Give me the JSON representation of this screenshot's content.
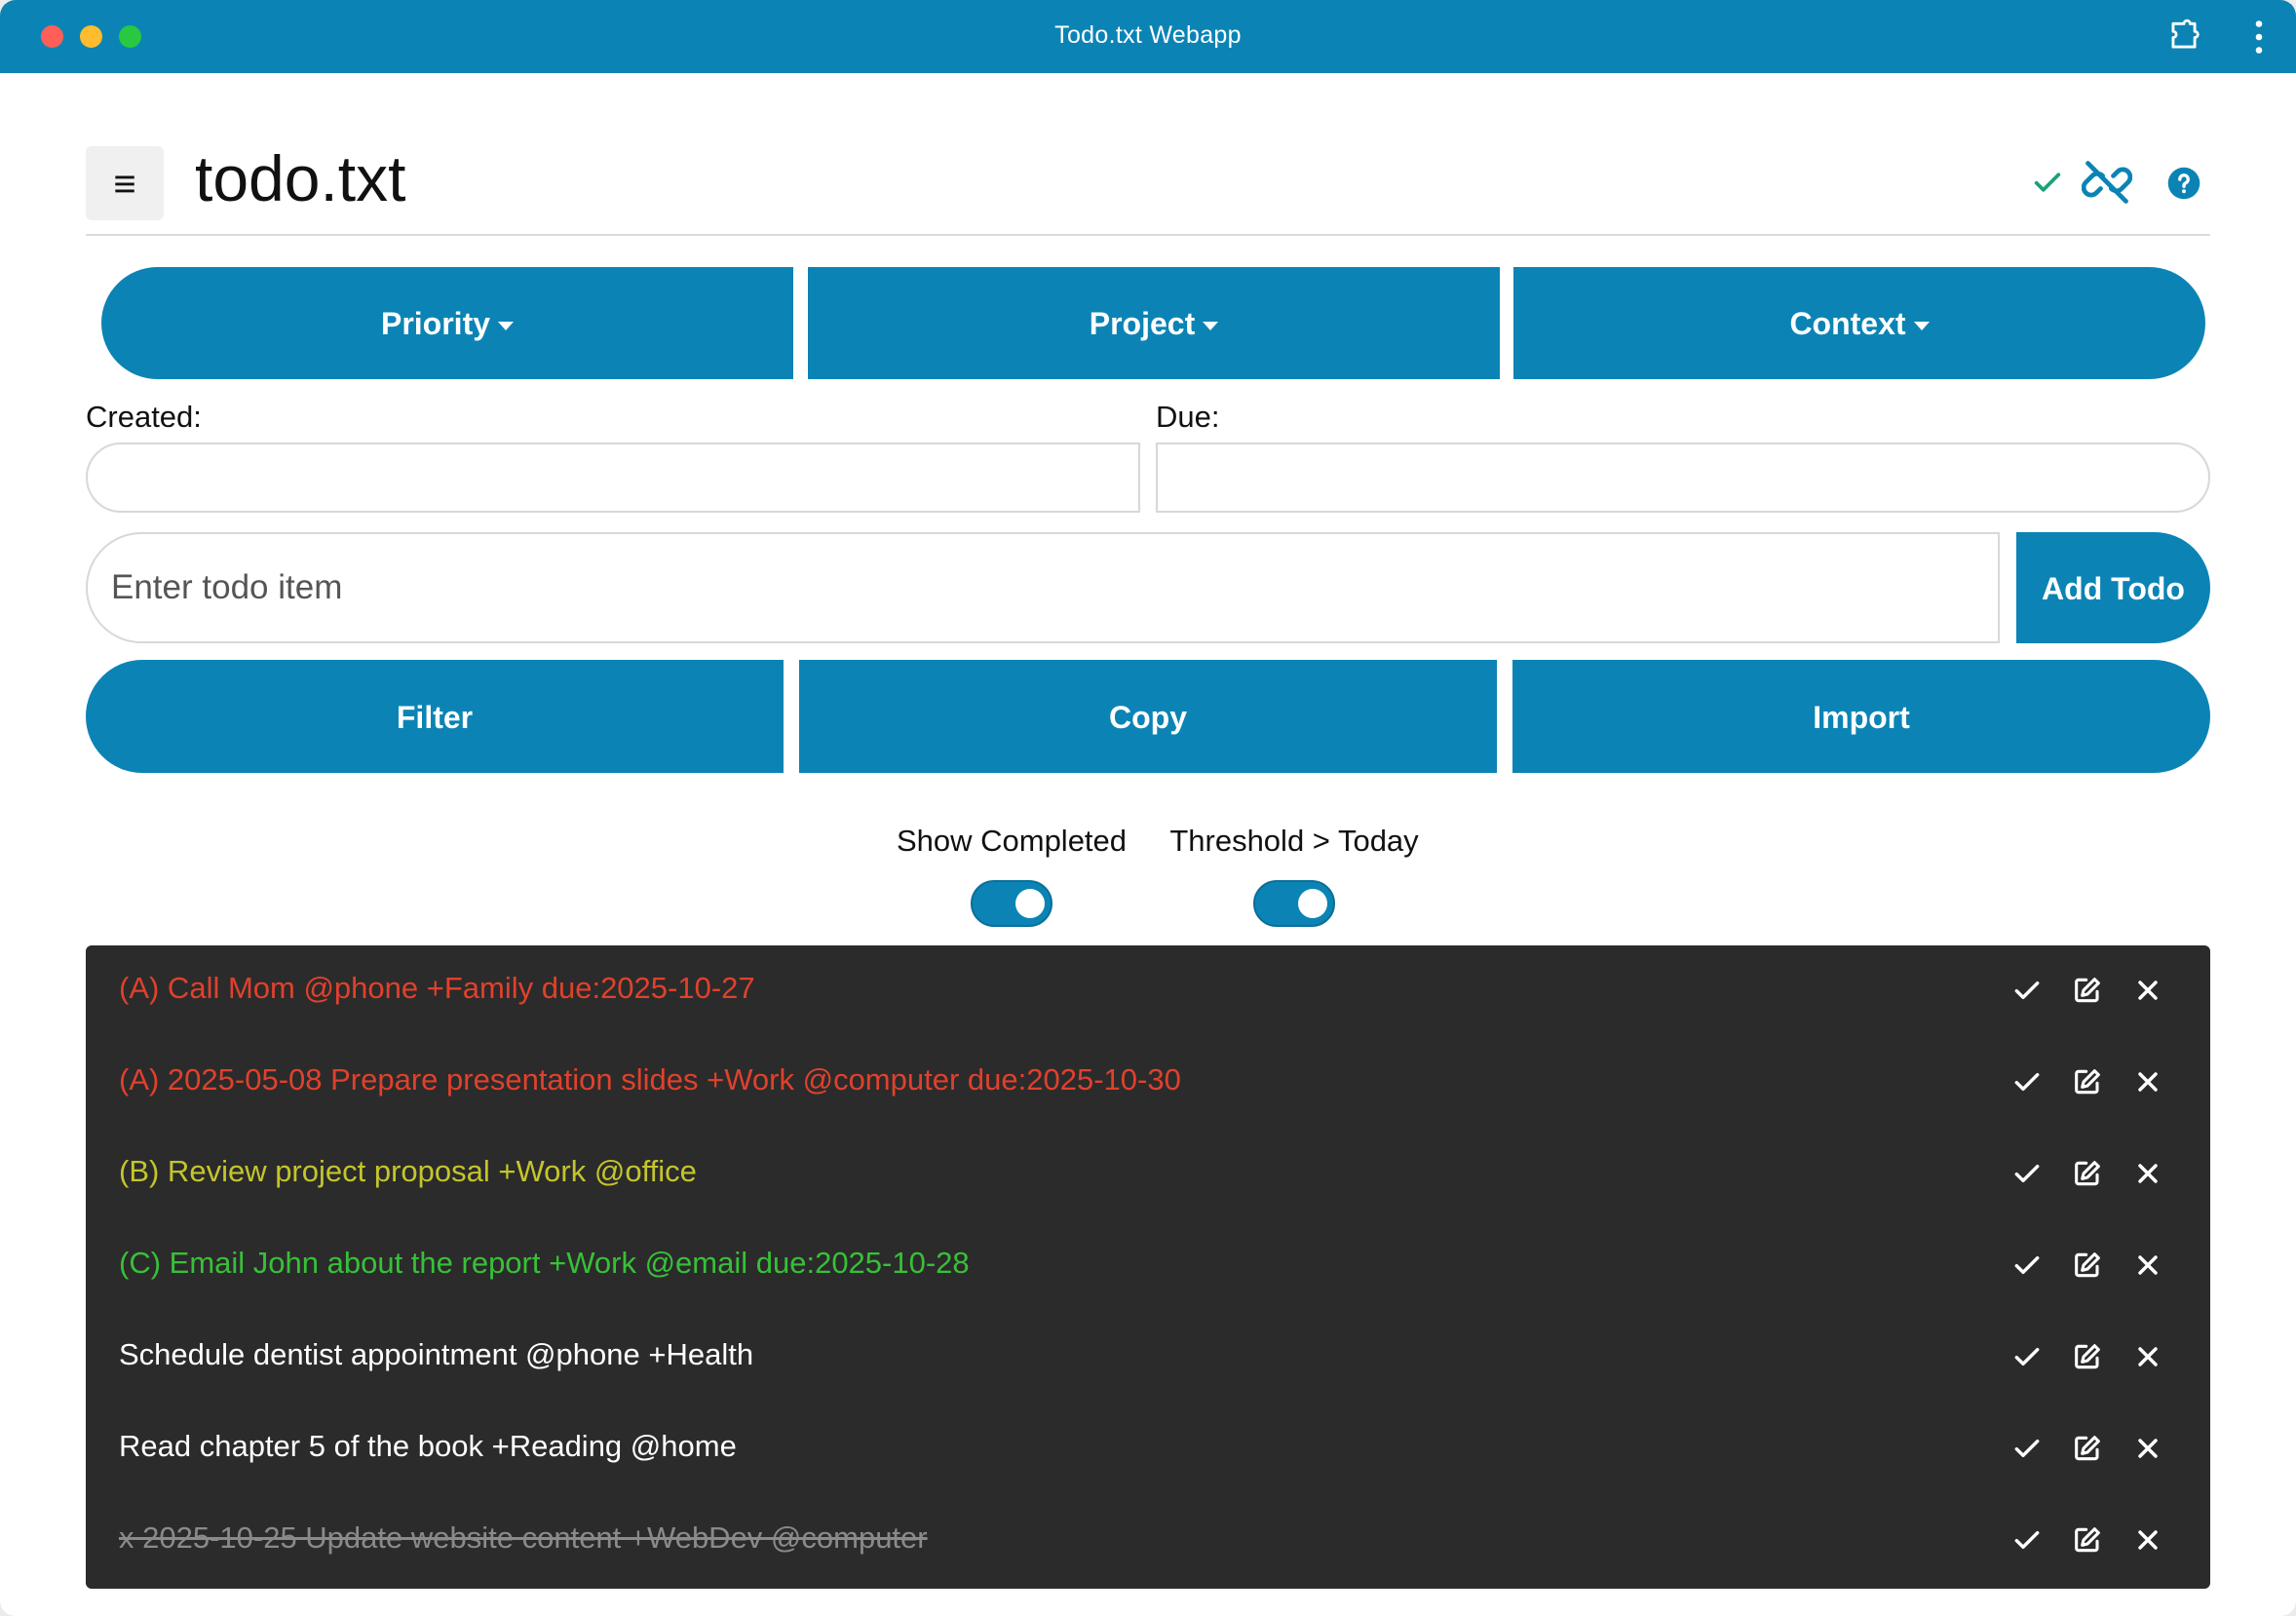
{
  "window": {
    "title": "Todo.txt Webapp"
  },
  "header": {
    "title": "todo.txt",
    "menu_glyph": "≡"
  },
  "dropdowns": {
    "priority": "Priority",
    "project": "Project",
    "context": "Context"
  },
  "dates": {
    "created_label": "Created:",
    "due_label": "Due:",
    "created_value": "",
    "due_value": ""
  },
  "todo_input": {
    "placeholder": "Enter todo item",
    "value": "",
    "add_label": "Add Todo"
  },
  "actions": {
    "filter": "Filter",
    "copy": "Copy",
    "import": "Import"
  },
  "toggles": {
    "show_completed": {
      "label": "Show Completed",
      "on": true
    },
    "threshold": {
      "label": "Threshold > Today",
      "on": true
    }
  },
  "colors": {
    "accent": "#0b84b5",
    "priority_a": "#e0412c",
    "priority_b": "#c4c52c",
    "priority_c": "#38c038",
    "normal": "#ffffff",
    "completed": "#8a8a8a",
    "list_bg": "#2b2b2b"
  },
  "todos": [
    {
      "text": "(A) Call Mom @phone +Family due:2025-10-27",
      "priority": "A",
      "completed": false
    },
    {
      "text": "(A) 2025-05-08 Prepare presentation slides +Work @computer due:2025-10-30",
      "priority": "A",
      "completed": false
    },
    {
      "text": "(B) Review project proposal +Work @office",
      "priority": "B",
      "completed": false
    },
    {
      "text": "(C) Email John about the report +Work @email due:2025-10-28",
      "priority": "C",
      "completed": false
    },
    {
      "text": "Schedule dentist appointment @phone +Health",
      "priority": "",
      "completed": false
    },
    {
      "text": "Read chapter 5 of the book +Reading @home",
      "priority": "",
      "completed": false
    },
    {
      "text": "x 2025-10-25 Update website content +WebDev @computer",
      "priority": "",
      "completed": true
    }
  ]
}
